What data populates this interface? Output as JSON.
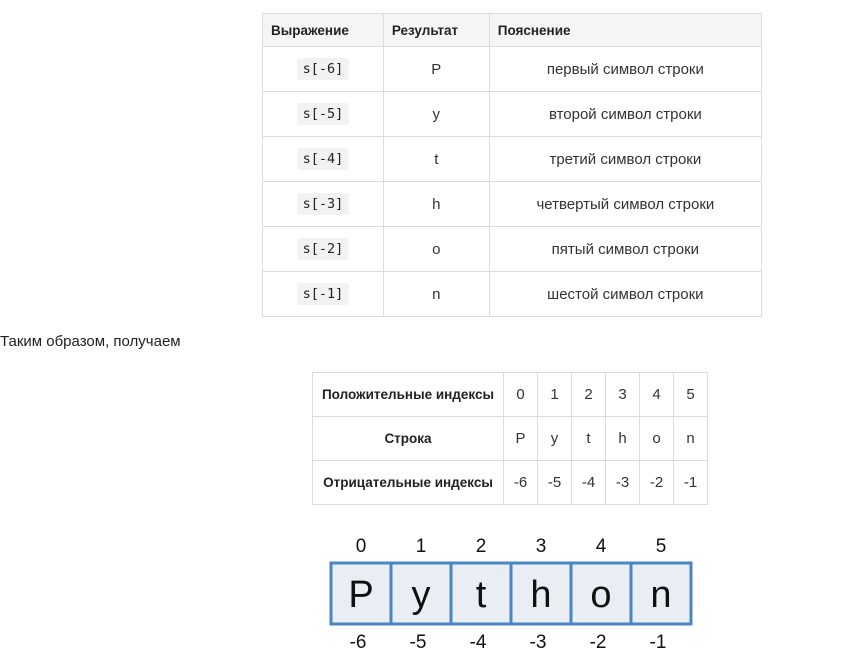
{
  "table1": {
    "headers": [
      "Выражение",
      "Результат",
      "Пояснение"
    ],
    "rows": [
      {
        "expr": "s[-6]",
        "result": "P",
        "note": "первый символ строки"
      },
      {
        "expr": "s[-5]",
        "result": "y",
        "note": "второй символ строки"
      },
      {
        "expr": "s[-4]",
        "result": "t",
        "note": "третий символ строки"
      },
      {
        "expr": "s[-3]",
        "result": "h",
        "note": "четвертый символ строки"
      },
      {
        "expr": "s[-2]",
        "result": "o",
        "note": "пятый символ строки"
      },
      {
        "expr": "s[-1]",
        "result": "n",
        "note": "шестой символ строки"
      }
    ]
  },
  "intro_text": "Таким образом, получаем",
  "table2": {
    "rows": [
      {
        "label": "Положительные индексы",
        "values": [
          "0",
          "1",
          "2",
          "3",
          "4",
          "5"
        ]
      },
      {
        "label": "Строка",
        "values": [
          "P",
          "y",
          "t",
          "h",
          "o",
          "n"
        ]
      },
      {
        "label": "Отрицательные индексы",
        "values": [
          "-6",
          "-5",
          "-4",
          "-3",
          "-2",
          "-1"
        ]
      }
    ]
  },
  "diagram": {
    "positive_indexes": [
      "0",
      "1",
      "2",
      "3",
      "4",
      "5"
    ],
    "letters": [
      "P",
      "y",
      "t",
      "h",
      "o",
      "n"
    ],
    "negative_indexes": [
      "-6",
      "-5",
      "-4",
      "-3",
      "-2",
      "-1"
    ],
    "box_fill": "#e8eef4",
    "box_stroke": "#4a86c5"
  }
}
